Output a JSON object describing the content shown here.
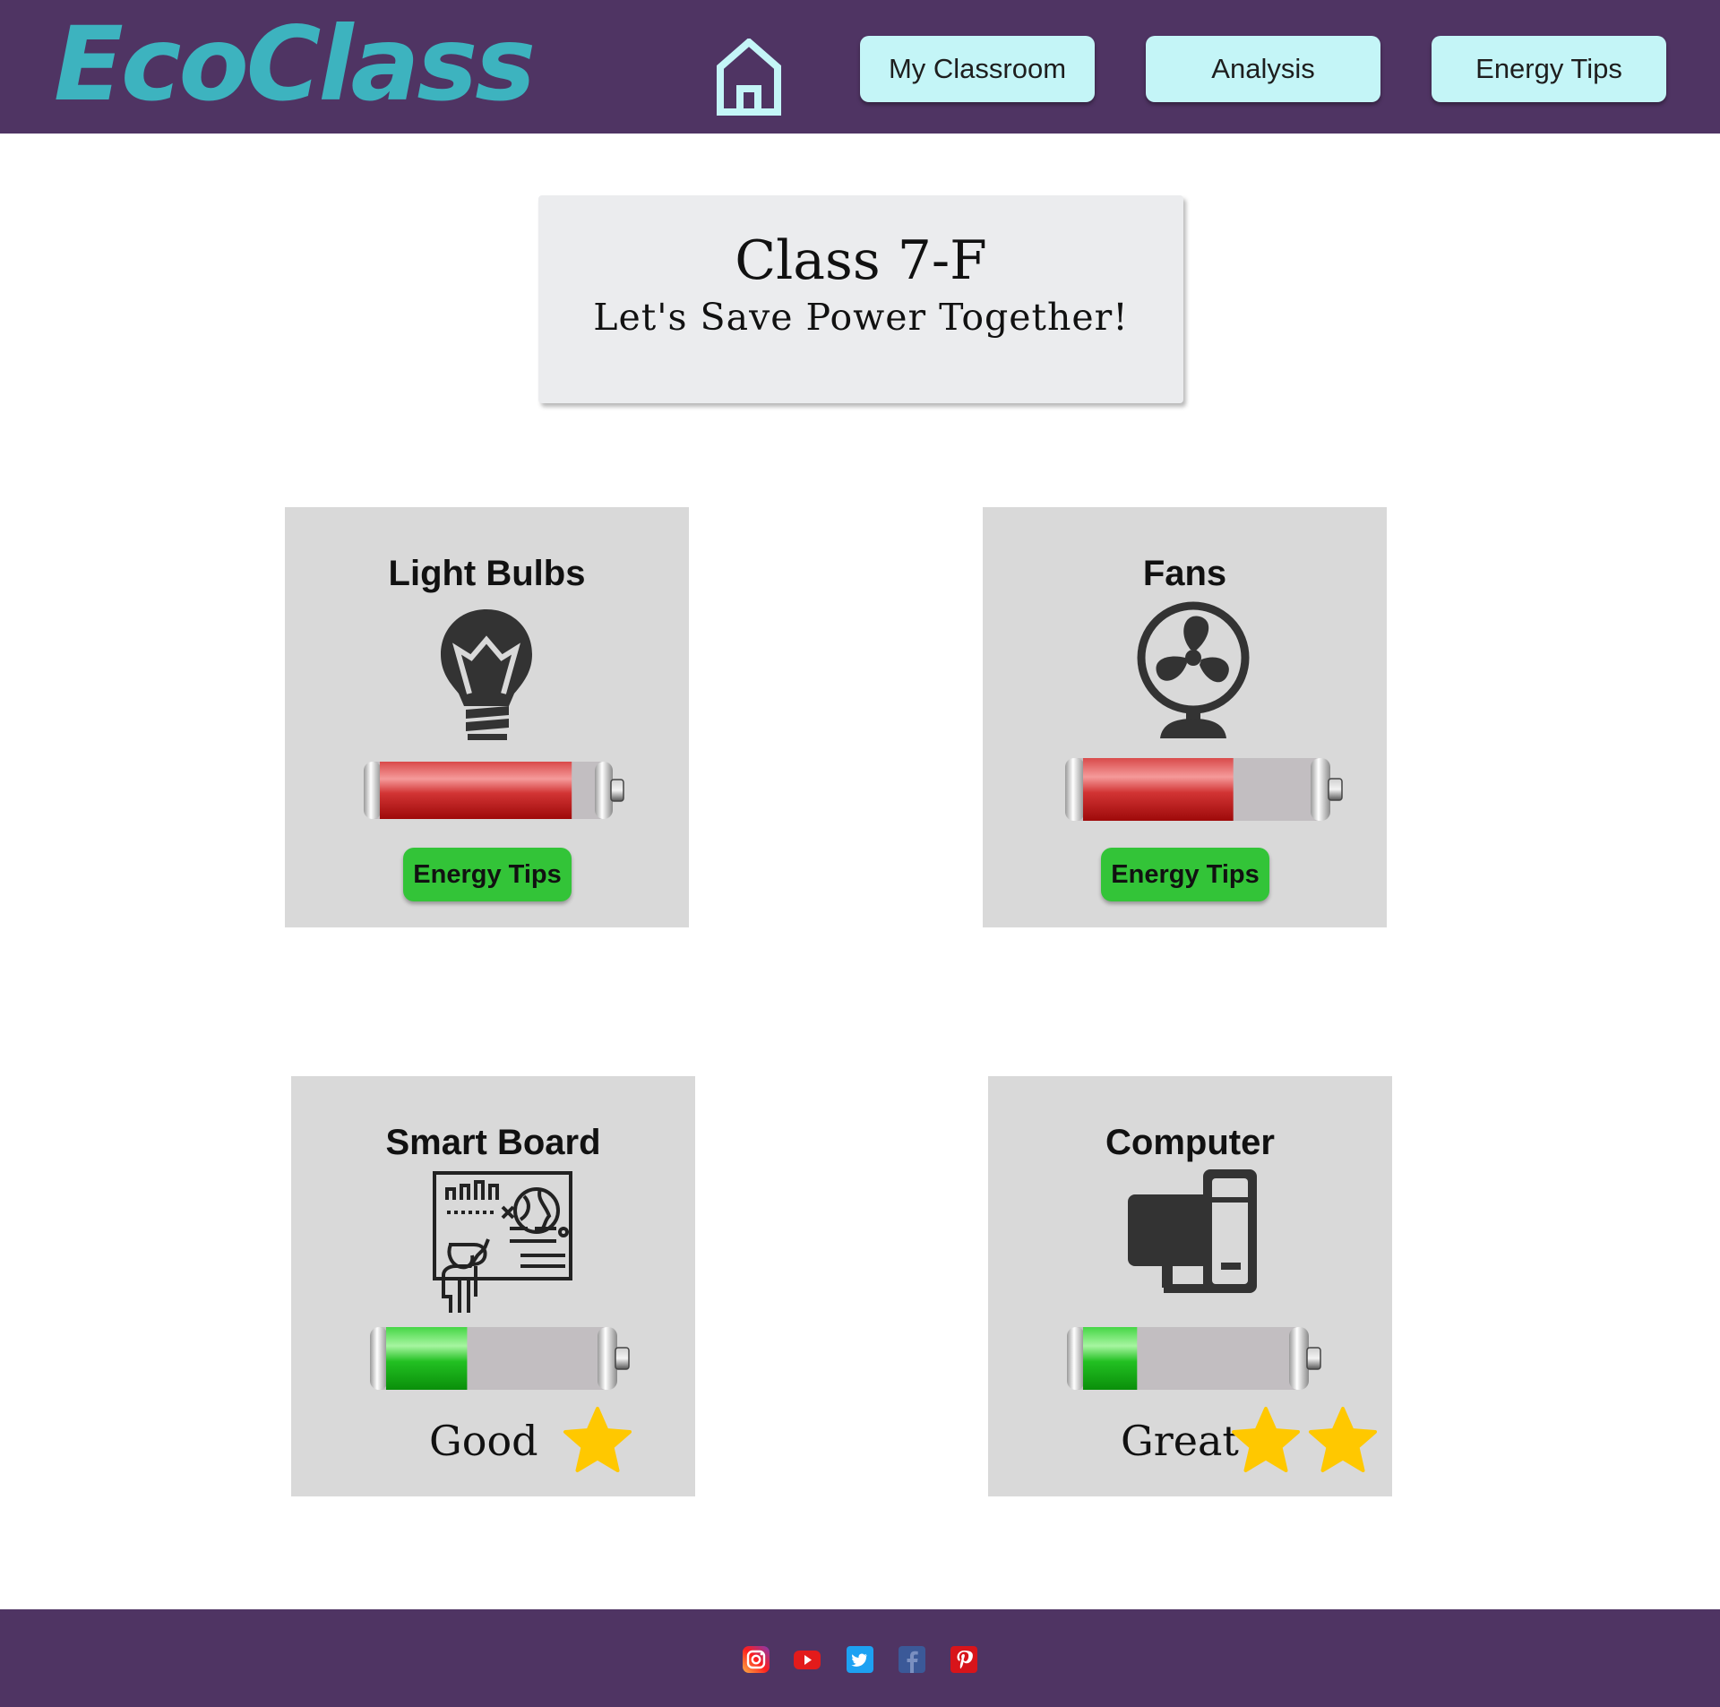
{
  "header": {
    "logo_text": "EcoClass",
    "home_icon": "home-icon",
    "nav": [
      {
        "label": "My Classroom"
      },
      {
        "label": "Analysis"
      },
      {
        "label": "Energy Tips"
      }
    ]
  },
  "hero": {
    "title": "Class 7-F",
    "subtitle": "Let's Save Power Together!"
  },
  "devices": [
    {
      "name": "Light Bulbs",
      "icon": "light-bulb-icon",
      "usage_level": 0.9,
      "level_color": "red",
      "button_label": "Energy Tips"
    },
    {
      "name": "Fans",
      "icon": "fan-icon",
      "usage_level": 0.65,
      "level_color": "red",
      "button_label": "Energy Tips"
    },
    {
      "name": "Smart Board",
      "icon": "smart-board-icon",
      "usage_level": 0.38,
      "level_color": "green",
      "rating_label": "Good",
      "stars": 1
    },
    {
      "name": "Computer",
      "icon": "computer-icon",
      "usage_level": 0.26,
      "level_color": "green",
      "rating_label": "Great",
      "stars": 2
    }
  ],
  "footer": {
    "social_icons": [
      "instagram-icon",
      "youtube-icon",
      "twitter-icon",
      "facebook-icon",
      "pinterest-icon"
    ]
  },
  "colors": {
    "header_bg": "#4f3463",
    "logo": "#3db3bf",
    "nav_button": "#c4f5f7",
    "card_bg": "#d9d9d9",
    "tips_button": "#33c438",
    "star": "#ffc800"
  }
}
